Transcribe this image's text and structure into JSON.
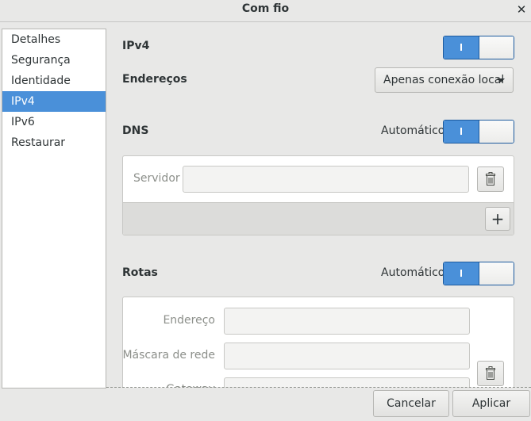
{
  "window": {
    "title": "Com fio",
    "close_glyph": "✕"
  },
  "sidebar": {
    "items": [
      {
        "label": "Detalhes"
      },
      {
        "label": "Segurança"
      },
      {
        "label": "Identidade"
      },
      {
        "label": "IPv4",
        "selected": true
      },
      {
        "label": "IPv6"
      },
      {
        "label": "Restaurar"
      }
    ]
  },
  "ipv4": {
    "heading": "IPv4",
    "enabled": true,
    "addresses_label": "Endereços",
    "addresses_method": "Apenas conexão local"
  },
  "dns": {
    "heading": "DNS",
    "automatic_label": "Automático",
    "automatic": true,
    "server_placeholder": "Servidor",
    "server_value": "",
    "add_glyph": "+"
  },
  "routes": {
    "heading": "Rotas",
    "automatic_label": "Automático",
    "automatic": true,
    "address_label": "Endereço",
    "netmask_label": "Máscara de rede",
    "gateway_label": "Gateway"
  },
  "buttons": {
    "cancel": "Cancelar",
    "apply": "Aplicar"
  },
  "colors": {
    "accent": "#4a90d9",
    "selection_text": "#ffffff",
    "window_bg": "#e8e8e7"
  },
  "icons": {
    "delete": "trash-icon",
    "add": "plus-icon",
    "close": "close-icon"
  }
}
